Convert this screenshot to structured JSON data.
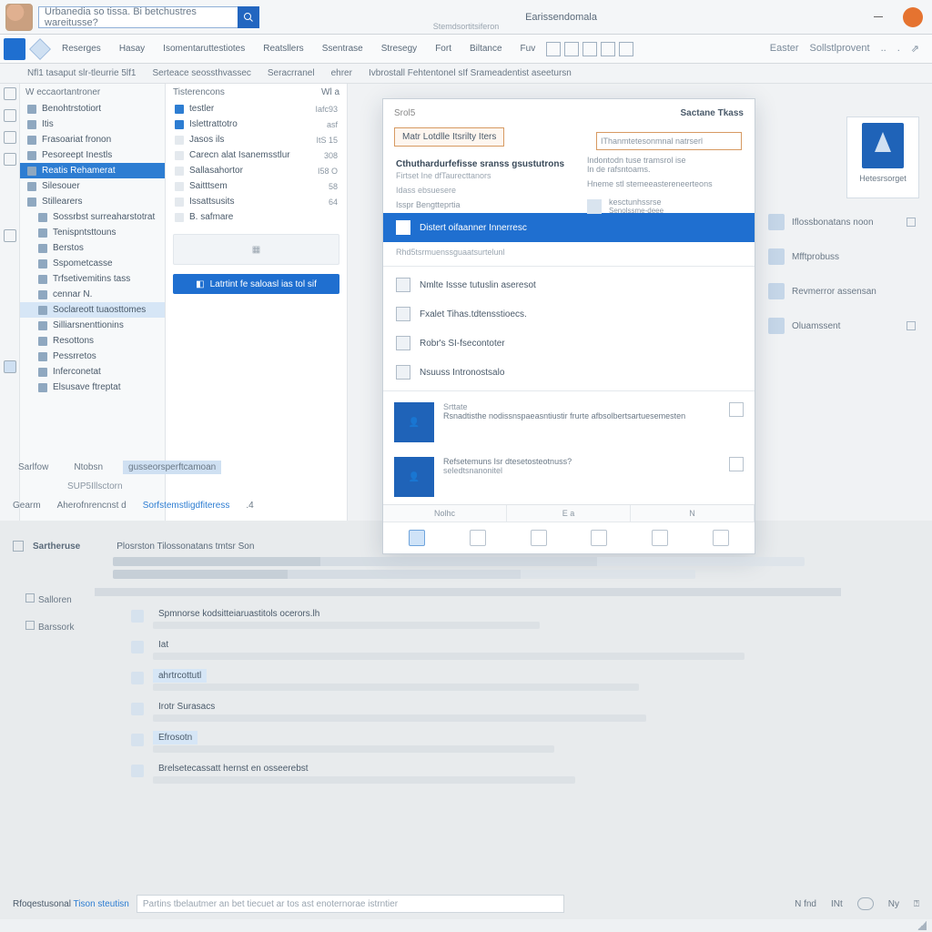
{
  "titlebar": {
    "search_placeholder": "Urbanedia so tissa. Bi betchustres wareitusse?",
    "title": "Earissendomala",
    "subtitle": "Stemdsortitsiferon"
  },
  "ribbon": {
    "items": [
      "Reserges",
      "Hasay",
      "Isomentaruttestiotes",
      "Reatsllers",
      "Ssentrase",
      "Stresegy",
      "Fort",
      "Biltance",
      "Fuv"
    ],
    "right": [
      "Easter",
      "Sollstlprovent",
      "..",
      "."
    ]
  },
  "subtabs": {
    "a": "Nfl1 tasaput slr-tleurrie 5lf1",
    "b": "Serteace seossthvassec",
    "c": "Seracrranel",
    "d": "ehrer",
    "e": "Ivbrostall Fehtentonel sIf Srameadentist aseetursn"
  },
  "nav": {
    "header": "W eccaortantroner",
    "items": [
      {
        "label": "Benohtrstotiort"
      },
      {
        "label": "Itis"
      },
      {
        "label": "Frasoariat fronon"
      },
      {
        "label": "Pesoreept Inestls"
      },
      {
        "label": "Reatis Rehamerat",
        "sel": true
      },
      {
        "label": "Silesouer"
      },
      {
        "label": "Stillearers"
      },
      {
        "label": "Sossrbst surreaharstotrat"
      },
      {
        "label": "Tenispntsttouns"
      },
      {
        "label": "Berstos"
      },
      {
        "label": "Sspometcasse"
      },
      {
        "label": "Trfsetivemitins tass"
      },
      {
        "label": "cennar N."
      },
      {
        "label": "Soclareott tuaosttomes",
        "semi": true
      },
      {
        "label": "Silliarsnenttionins"
      },
      {
        "label": "Resottons"
      },
      {
        "label": "Pessrretos"
      },
      {
        "label": "Inferconetat"
      },
      {
        "label": "Elsusave ftreptat"
      }
    ]
  },
  "list": {
    "header_l": "Tisterencons",
    "header_r": "Wl a",
    "rows": [
      {
        "label": "testler",
        "r": "Iafc93"
      },
      {
        "label": "Islettrattotro",
        "r": "asf"
      },
      {
        "label": "Jasos ils",
        "r": "ItS 15"
      },
      {
        "label": "Carecn alat Isanemsstlur",
        "r": "308"
      },
      {
        "label": "Sallasahortor",
        "r": "I58 O"
      },
      {
        "label": "Saitttsem",
        "r": "58"
      },
      {
        "label": "Issattsusits",
        "r": "64"
      },
      {
        "label": "B. safmare",
        "r": ""
      }
    ],
    "button": "Latrtint fe saloasl ias tol sif"
  },
  "rightcard": {
    "caption": "Hetesrsorget"
  },
  "rightlist": [
    {
      "label": "Iflossbonatans noon"
    },
    {
      "label": "Mfftprobuss"
    },
    {
      "label": "Revmerror assensan"
    },
    {
      "label": "Oluamssent"
    }
  ],
  "dialog": {
    "head_l": "Srol5",
    "head_r": "Sactane Tkass",
    "chip": "Matr Lotdlle  Itsrilty Iters",
    "search_ph": "IThanmtetesonmnal natrserl",
    "top_line1": "Cthuthardurfefisse sranss gsustutrons",
    "meta1": "Firtset Ine dfTaurecttanors",
    "meta2": "Idass  ebsuesere",
    "meta3": "Isspr   Bengtteprtia",
    "sel_label": "Distert oifaanner Innerresc",
    "after_sel": "Rhd5tsrmuenssguaatsurtelunl",
    "right_text1": "Indontodn tuse tramsrol ise",
    "right_text2": "In de rafsntoams.",
    "right_text3": "Hneme   stl stemeeastereneerteons",
    "ritem1": "kesctunhssrse",
    "ritem2": "Senolssme-deee",
    "options": [
      {
        "label": "Nmlte Issse tutuslin aseresot"
      },
      {
        "label": "Fxalet Tihas.tdtensstioecs."
      },
      {
        "label": "Robr's SI-fsecontoter"
      },
      {
        "label": "Nsuuss Intronostsalo"
      }
    ],
    "persons": [
      {
        "tag": "Srttate",
        "desc": "Rsnadtisthe nodissnspaeasntiustir frurte afbsolbertsartuesemesten"
      },
      {
        "tag": "",
        "desc": "Refsetemuns Isr dtesetosteotnuss?",
        "sub": "seledtsnanonitel"
      }
    ],
    "bottabs": [
      "Nolhc",
      "E a",
      "N"
    ]
  },
  "midtabs": {
    "row": [
      "Sarlfow",
      "Ntobsn",
      "gusseorsperftcamoan"
    ],
    "path": "SUP5Illsctorn",
    "crumbs_label": "Gearm",
    "crumbs": [
      "Aherofnrencnst d",
      "Sorfstemstligdfiteress",
      ".4"
    ]
  },
  "doc": {
    "section": "Sartheruse",
    "meta": "Plosrston Tilossonatans tmtsr   Son",
    "side1": "Salloren",
    "side2": "Barssork",
    "items": [
      {
        "h": "Spmnorse kodsitteiaruastitols ocerors.lh",
        "hl": false
      },
      {
        "h": "Iat",
        "hl": false
      },
      {
        "h": "ahrtrcottutl",
        "hl": true
      },
      {
        "h": "Irotr  Surasacs",
        "hl": false
      },
      {
        "h": "Efrosotn",
        "hl": true
      },
      {
        "h": "Brelsetecassatt hernst en osseerebst",
        "hl": false
      }
    ]
  },
  "bottombar": {
    "label_a": "Rfoqestusonal",
    "label_b": "Tison  steutisn",
    "field_ph": "Partins tbelautmer an bet tiecuet  ar tos ast enoternorae istrntier",
    "r1": "N fnd",
    "r2": "INt",
    "r3": "Ny"
  }
}
